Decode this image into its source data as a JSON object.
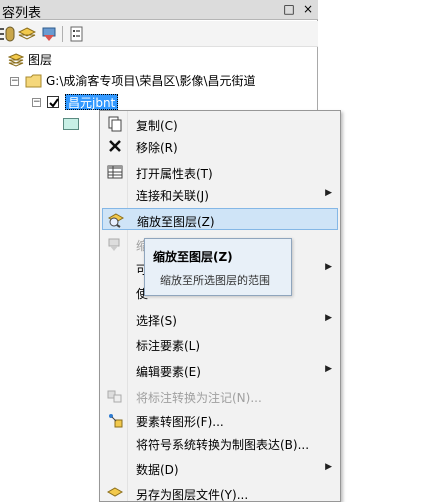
{
  "panel": {
    "title": "容列表",
    "restore_symbol": "□",
    "close_symbol": "×"
  },
  "toolbar": {
    "icons": [
      "list-by-drawing-order-icon",
      "list-by-source-icon",
      "list-by-visibility-icon",
      "list-by-selection-icon",
      "options-icon"
    ]
  },
  "tree": {
    "root_label": "图层",
    "folder_path": "G:\\成渝客专项目\\荣昌区\\影像\\昌元街道",
    "layer_name": "昌元jbnt",
    "symbol_color": "#c8f0e6"
  },
  "menu": {
    "items": [
      {
        "label": "复制(C)",
        "icon": "copy-icon"
      },
      {
        "label": "移除(R)",
        "icon": "remove-icon"
      },
      {
        "label": "打开属性表(T)",
        "icon": "attribute-table-icon"
      },
      {
        "label": "连接和关联(J)",
        "icon": "",
        "submenu": "▶"
      },
      {
        "label": "缩放至图层(Z)",
        "icon": "zoom-to-layer-icon"
      },
      {
        "label": "缩",
        "icon": "zoom-to-visible-scale-icon"
      },
      {
        "label": "可",
        "icon": "",
        "submenu": "▶"
      },
      {
        "label": "使",
        "icon": ""
      },
      {
        "label": "选择(S)",
        "icon": "",
        "submenu": "▶"
      },
      {
        "label": "标注要素(L)",
        "icon": ""
      },
      {
        "label": "编辑要素(E)",
        "icon": "",
        "submenu": "▶"
      },
      {
        "label": "将标注转换为注记(N)...",
        "icon": "convert-labels-icon"
      },
      {
        "label": "要素转图形(F)...",
        "icon": "features-to-graphics-icon"
      },
      {
        "label": "将符号系统转换为制图表达(B)...",
        "icon": ""
      },
      {
        "label": "数据(D)",
        "icon": "",
        "submenu": "▶"
      },
      {
        "label": "另存为图层文件(Y)...",
        "icon": "save-layer-file-icon"
      }
    ]
  },
  "tooltip": {
    "title": "缩放至图层(Z)",
    "description": "缩放至所选图层的范围"
  },
  "colors": {
    "hover_bg": "#cfe4f7",
    "hover_border": "#84b7e6",
    "layer_highlight": "#3399ff"
  }
}
